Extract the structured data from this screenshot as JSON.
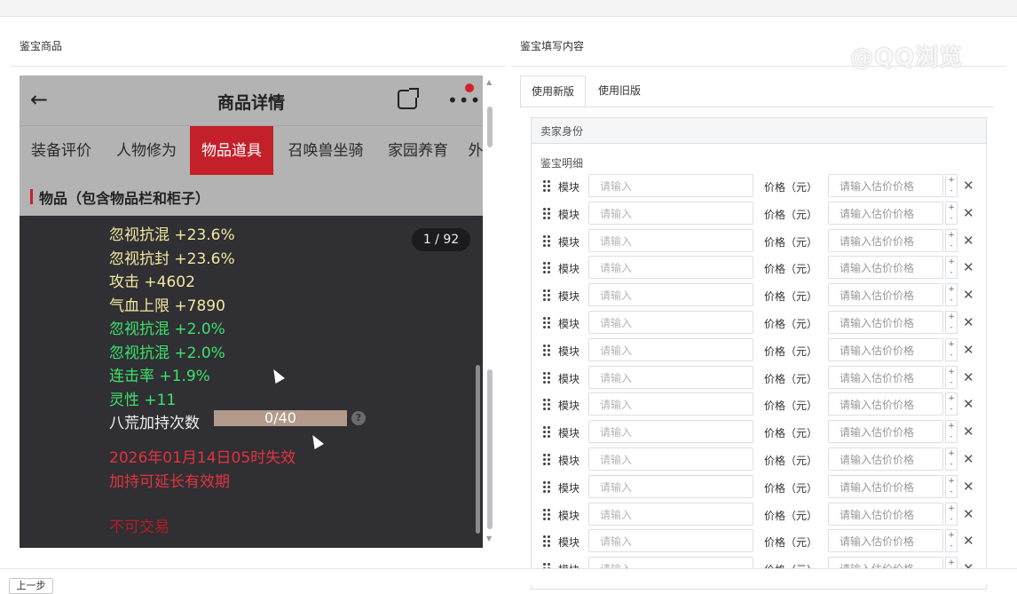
{
  "left": {
    "title": "鉴宝商品",
    "phone": {
      "back_icon": "arrow-left-icon",
      "header_title": "商品详情",
      "tabs": [
        "装备评价",
        "人物修为",
        "物品道具",
        "召唤兽坐骑",
        "家园养育",
        "外"
      ],
      "active_tab": "物品道具",
      "section_title": "物品（包含物品栏和柜子）",
      "counter": "1 / 92",
      "attributes": [
        {
          "text": "忽视抗混 +23.6%",
          "color": "yellow"
        },
        {
          "text": "忽视抗封 +23.6%",
          "color": "yellow"
        },
        {
          "text": "攻击 +4602",
          "color": "yellow"
        },
        {
          "text": "气血上限 +7890",
          "color": "yellow"
        },
        {
          "text": "忽视抗混 +2.0%",
          "color": "green"
        },
        {
          "text": "忽视抗混 +2.0%",
          "color": "green"
        },
        {
          "text": "连击率 +1.9%",
          "color": "green"
        },
        {
          "text": "灵性 +11",
          "color": "green"
        }
      ],
      "bagua_label": "八荒加持次数",
      "bagua_value": "0/40",
      "bagua_progress": 0,
      "expire_text": "2026年01月14日05时失效",
      "extend_text": "加持可延长有效期",
      "not_tradable": "不可交易"
    }
  },
  "right": {
    "title": "鉴宝填写内容",
    "tabs": [
      "使用新版",
      "使用旧版"
    ],
    "active_tab": "使用新版",
    "seller_section": "卖家身份",
    "detail_label": "鉴宝明细",
    "row_module_label": "模块",
    "row_input_placeholder": "请输入",
    "row_price_label": "价格（元）",
    "row_price_placeholder": "请输入估价价格",
    "row_count": 15
  },
  "footer": {
    "button_label": "上一步"
  },
  "watermark": "@QQ浏览"
}
